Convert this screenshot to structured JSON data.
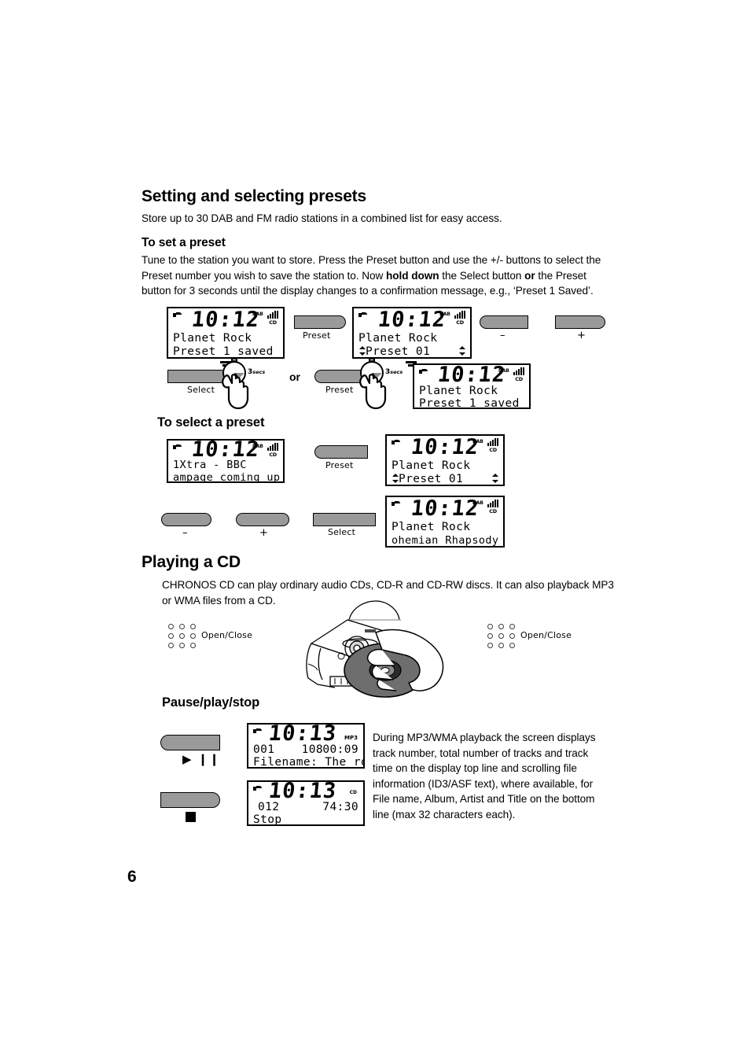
{
  "page": {
    "number": "6"
  },
  "section_presets": {
    "title": "Setting and selecting presets",
    "intro": "Store up to 30 DAB and FM radio stations in a combined list for easy access.",
    "set_preset": {
      "heading": "To set a preset",
      "paragraph_part1": "Tune to the station you want to store. Press the Preset button and use the +/- buttons to select the Preset number you wish to save the station to. Now ",
      "paragraph_bold1": "hold down",
      "paragraph_part2": " the Select button ",
      "paragraph_bold2": "or",
      "paragraph_part3": " the Preset button for 3 seconds until the display changes to a confirmation message, e.g., ‘Preset 1 Saved’."
    },
    "select_preset": {
      "heading": "To select a preset"
    },
    "or_word": "or"
  },
  "displays": {
    "preset_saved_1": {
      "clock": "10:12",
      "line1": "Planet Rock",
      "line2": "Preset 1 saved",
      "dab": "DAB",
      "cd": "CD"
    },
    "preset_01": {
      "clock": "10:12",
      "line1": "Planet Rock",
      "line2": "Preset 01",
      "dab": "DAB",
      "cd": "CD"
    },
    "preset_saved_2": {
      "clock": "10:12",
      "line1": "Planet Rock",
      "line2": "Preset 1 saved",
      "dab": "DAB",
      "cd": "CD"
    },
    "now_playing_1xtra": {
      "clock": "10:12",
      "line1": "1Xtra - BBC",
      "line2": "ampage coming up",
      "dab": "DAB",
      "cd": "CD"
    },
    "preset_01_select": {
      "clock": "10:12",
      "line1": "Planet Rock",
      "line2": "Preset 01",
      "dab": "DAB",
      "cd": "CD"
    },
    "playing_rhapsody": {
      "clock": "10:12",
      "line1": "Planet Rock",
      "line2": "ohemian Rhapsody",
      "dab": "DAB",
      "cd": "CD"
    },
    "cd_playing": {
      "clock": "10:13",
      "track_number": "001",
      "total_tracks": "108",
      "track_time": "00:09",
      "line2": "Filename: The ro",
      "mp3_marker": "MP3"
    },
    "cd_stopped": {
      "clock": "10:13",
      "total_tracks": "012",
      "total_time": "74:30",
      "line2": "Stop",
      "mp3_marker": "CD"
    }
  },
  "buttons": {
    "preset": "Preset",
    "select": "Select",
    "minus": "–",
    "plus": "+",
    "three_secs_number": "3",
    "three_secs_unit": "secs",
    "open_close": "Open/Close",
    "play_pause_glyph": "▶ ❙❙"
  },
  "section_cd": {
    "title": "Playing a CD",
    "intro": "CHRONOS CD can play ordinary audio CDs, CD-R and CD-RW discs. It can also playback MP3 or WMA files from a CD.",
    "pause_play_stop": {
      "heading": "Pause/play/stop",
      "paragraph": "During MP3/WMA playback the screen displays track number, total number of tracks and track time on the display top line and scrolling file information (ID3/ASF text), where available, for File name, Album, Artist and Title on the bottom line (max 32 characters each)."
    }
  }
}
